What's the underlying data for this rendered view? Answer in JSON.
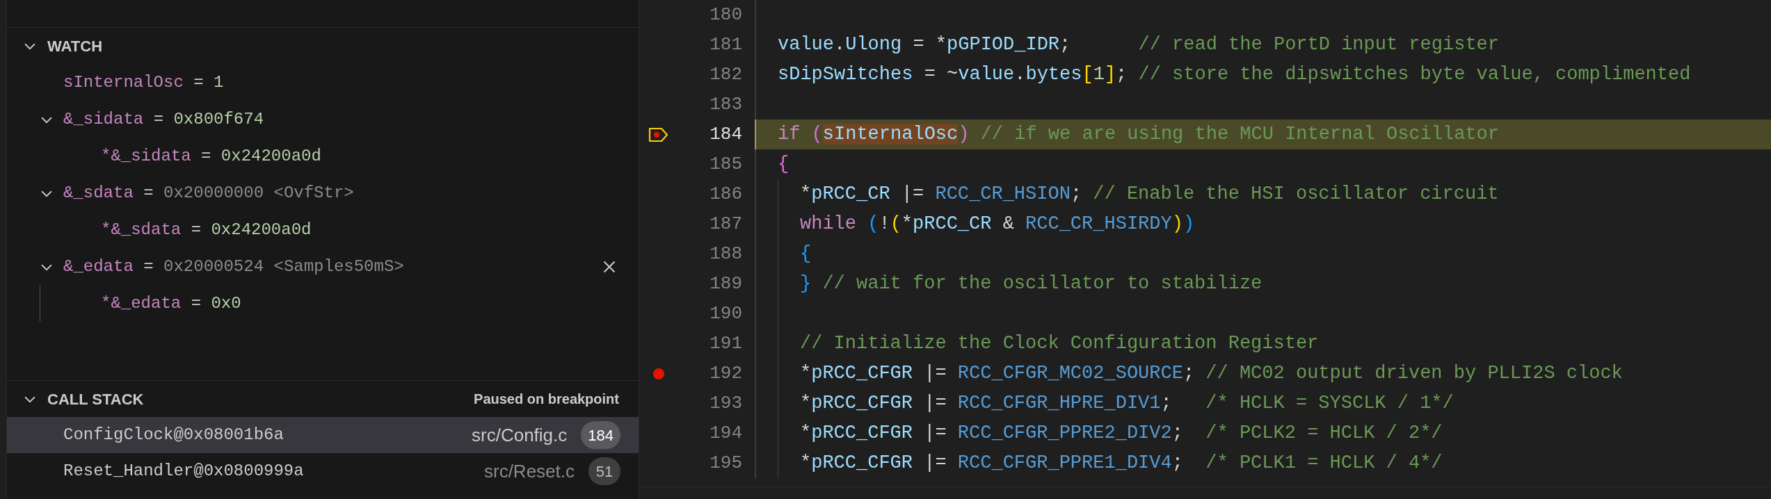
{
  "watch": {
    "title": "WATCH",
    "expanded": true,
    "items": [
      {
        "name": "sInternalOsc",
        "operator": "=",
        "value": "1",
        "dimmed": false,
        "hovered": false
      },
      {
        "name": "&_sidata",
        "operator": "=",
        "value": "0x800f674",
        "dimmed": false,
        "expanded": true,
        "hovered": false,
        "children": [
          {
            "name": "*&_sidata",
            "operator": "=",
            "value": "0x24200a0d",
            "dimmed": false
          }
        ]
      },
      {
        "name": "&_sdata",
        "operator": "=",
        "value": "0x20000000",
        "type": "<OvfStr>",
        "dimmed": true,
        "expanded": true,
        "hovered": false,
        "children": [
          {
            "name": "*&_sdata",
            "operator": "=",
            "value": "0x24200a0d",
            "dimmed": false
          }
        ]
      },
      {
        "name": "&_edata",
        "operator": "=",
        "value": "0x20000524",
        "type": "<Samples50mS>",
        "dimmed": true,
        "expanded": true,
        "hovered": true,
        "children": [
          {
            "name": "*&_edata",
            "operator": "=",
            "value": "0x0",
            "dimmed": false
          }
        ]
      }
    ]
  },
  "call_stack": {
    "title": "CALL STACK",
    "expanded": true,
    "status": "Paused on breakpoint",
    "frames": [
      {
        "name": "ConfigClock@0x08001b6a",
        "file": "src/Config.c",
        "line": "184",
        "selected": true
      },
      {
        "name": "Reset_Handler@0x0800999a",
        "file": "src/Reset.c",
        "line": "51",
        "selected": false
      }
    ]
  },
  "editor": {
    "lines": [
      {
        "number": "180",
        "breakpoint": false,
        "current": false,
        "nested": false
      },
      {
        "number": "181",
        "breakpoint": false,
        "current": false,
        "nested": false,
        "tokens": [
          {
            "kind": "var",
            "text": "value"
          },
          {
            "kind": "op",
            "text": "."
          },
          {
            "kind": "var",
            "text": "Ulong"
          },
          {
            "kind": "op",
            "text": " = *"
          },
          {
            "kind": "var",
            "text": "pGPIOD_IDR"
          },
          {
            "kind": "op",
            "text": ";      "
          },
          {
            "kind": "comment",
            "text": "// read the PortD input register"
          }
        ]
      },
      {
        "number": "182",
        "breakpoint": false,
        "current": false,
        "nested": false,
        "tokens": [
          {
            "kind": "var",
            "text": "sDipSwitches"
          },
          {
            "kind": "op",
            "text": " = ~"
          },
          {
            "kind": "var",
            "text": "value"
          },
          {
            "kind": "op",
            "text": "."
          },
          {
            "kind": "var",
            "text": "bytes"
          },
          {
            "kind": "bracket1",
            "text": "["
          },
          {
            "kind": "number",
            "text": "1"
          },
          {
            "kind": "bracket1",
            "text": "]"
          },
          {
            "kind": "op",
            "text": "; "
          },
          {
            "kind": "comment",
            "text": "// store the dipswitches byte value, complimented"
          }
        ]
      },
      {
        "number": "183",
        "breakpoint": false,
        "current": false,
        "nested": false
      },
      {
        "number": "184",
        "breakpoint": true,
        "current": true,
        "nested": false,
        "tokens": [
          {
            "kind": "keyword",
            "text": "if"
          },
          {
            "kind": "bracket2",
            "text": " ("
          },
          {
            "kind": "highlight",
            "text": "sInternalOsc"
          },
          {
            "kind": "bracket2",
            "text": ")"
          },
          {
            "kind": "comment",
            "text": " // if we are using the MCU Internal Oscillator"
          }
        ]
      },
      {
        "number": "185",
        "breakpoint": false,
        "current": false,
        "nested": false,
        "tokens": [
          {
            "kind": "bracket2",
            "text": "{"
          }
        ]
      },
      {
        "number": "186",
        "breakpoint": false,
        "current": false,
        "nested": true,
        "tokens": [
          {
            "kind": "op",
            "text": "*"
          },
          {
            "kind": "var",
            "text": "pRCC_CR"
          },
          {
            "kind": "op",
            "text": " |= "
          },
          {
            "kind": "macro",
            "text": "RCC_CR_HSION"
          },
          {
            "kind": "op",
            "text": "; "
          },
          {
            "kind": "comment",
            "text": "// Enable the HSI oscillator circuit"
          }
        ]
      },
      {
        "number": "187",
        "breakpoint": false,
        "current": false,
        "nested": true,
        "tokens": [
          {
            "kind": "keyword",
            "text": "while"
          },
          {
            "kind": "bracket3",
            "text": " ("
          },
          {
            "kind": "op",
            "text": "!"
          },
          {
            "kind": "bracket1",
            "text": "("
          },
          {
            "kind": "op",
            "text": "*"
          },
          {
            "kind": "var",
            "text": "pRCC_CR"
          },
          {
            "kind": "op",
            "text": " & "
          },
          {
            "kind": "macro",
            "text": "RCC_CR_HSIRDY"
          },
          {
            "kind": "bracket1",
            "text": ")"
          },
          {
            "kind": "bracket3",
            "text": ")"
          }
        ]
      },
      {
        "number": "188",
        "breakpoint": false,
        "current": false,
        "nested": true,
        "tokens": [
          {
            "kind": "bracket3",
            "text": "{"
          }
        ]
      },
      {
        "number": "189",
        "breakpoint": false,
        "current": false,
        "nested": true,
        "tokens": [
          {
            "kind": "bracket3",
            "text": "}"
          },
          {
            "kind": "comment",
            "text": " // wait for the oscillator to stabilize"
          }
        ]
      },
      {
        "number": "190",
        "breakpoint": false,
        "current": false,
        "nested": true
      },
      {
        "number": "191",
        "breakpoint": false,
        "current": false,
        "nested": true,
        "tokens": [
          {
            "kind": "comment",
            "text": "// Initialize the Clock Configuration Register"
          }
        ]
      },
      {
        "number": "192",
        "breakpoint": true,
        "current": false,
        "nested": true,
        "tokens": [
          {
            "kind": "op",
            "text": "*"
          },
          {
            "kind": "var",
            "text": "pRCC_CFGR"
          },
          {
            "kind": "op",
            "text": " |= "
          },
          {
            "kind": "macro",
            "text": "RCC_CFGR_MC02_SOURCE"
          },
          {
            "kind": "op",
            "text": "; "
          },
          {
            "kind": "comment",
            "text": "// MC02 output driven by PLLI2S clock"
          }
        ]
      },
      {
        "number": "193",
        "breakpoint": false,
        "current": false,
        "nested": true,
        "tokens": [
          {
            "kind": "op",
            "text": "*"
          },
          {
            "kind": "var",
            "text": "pRCC_CFGR"
          },
          {
            "kind": "op",
            "text": " |= "
          },
          {
            "kind": "macro",
            "text": "RCC_CFGR_HPRE_DIV1"
          },
          {
            "kind": "op",
            "text": ";   "
          },
          {
            "kind": "comment",
            "text": "/* HCLK = SYSCLK / 1*/"
          }
        ]
      },
      {
        "number": "194",
        "breakpoint": false,
        "current": false,
        "nested": true,
        "tokens": [
          {
            "kind": "op",
            "text": "*"
          },
          {
            "kind": "var",
            "text": "pRCC_CFGR"
          },
          {
            "kind": "op",
            "text": " |= "
          },
          {
            "kind": "macro",
            "text": "RCC_CFGR_PPRE2_DIV2"
          },
          {
            "kind": "op",
            "text": ";  "
          },
          {
            "kind": "comment",
            "text": "/* PCLK2 = HCLK / 2*/"
          }
        ]
      },
      {
        "number": "195",
        "breakpoint": false,
        "current": false,
        "nested": true,
        "tokens": [
          {
            "kind": "op",
            "text": "*"
          },
          {
            "kind": "var",
            "text": "pRCC_CFGR"
          },
          {
            "kind": "op",
            "text": " |= "
          },
          {
            "kind": "macro",
            "text": "RCC_CFGR_PPRE1_DIV4"
          },
          {
            "kind": "op",
            "text": ";  "
          },
          {
            "kind": "comment",
            "text": "/* PCLK1 = HCLK / 4*/"
          }
        ]
      }
    ]
  }
}
